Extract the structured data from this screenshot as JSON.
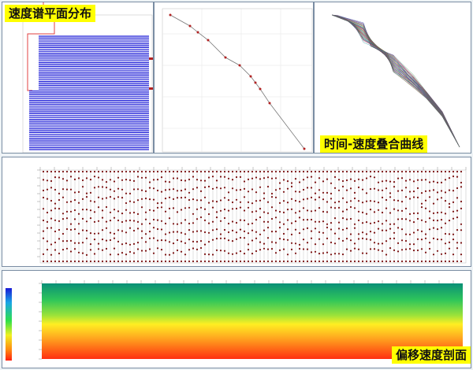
{
  "panels": {
    "velocity_map": {
      "label": "速度谱平面分布"
    },
    "velocity_curve": {
      "label": "时间-速度叠合曲线"
    },
    "migration_section": {
      "label": "偏移速度剖面"
    }
  },
  "colors": {
    "label_bg": "#ffff00",
    "map_lines": "#1a1ad6",
    "curve_marker": "#b22222",
    "spectrum_dots": "#7a1010"
  }
}
